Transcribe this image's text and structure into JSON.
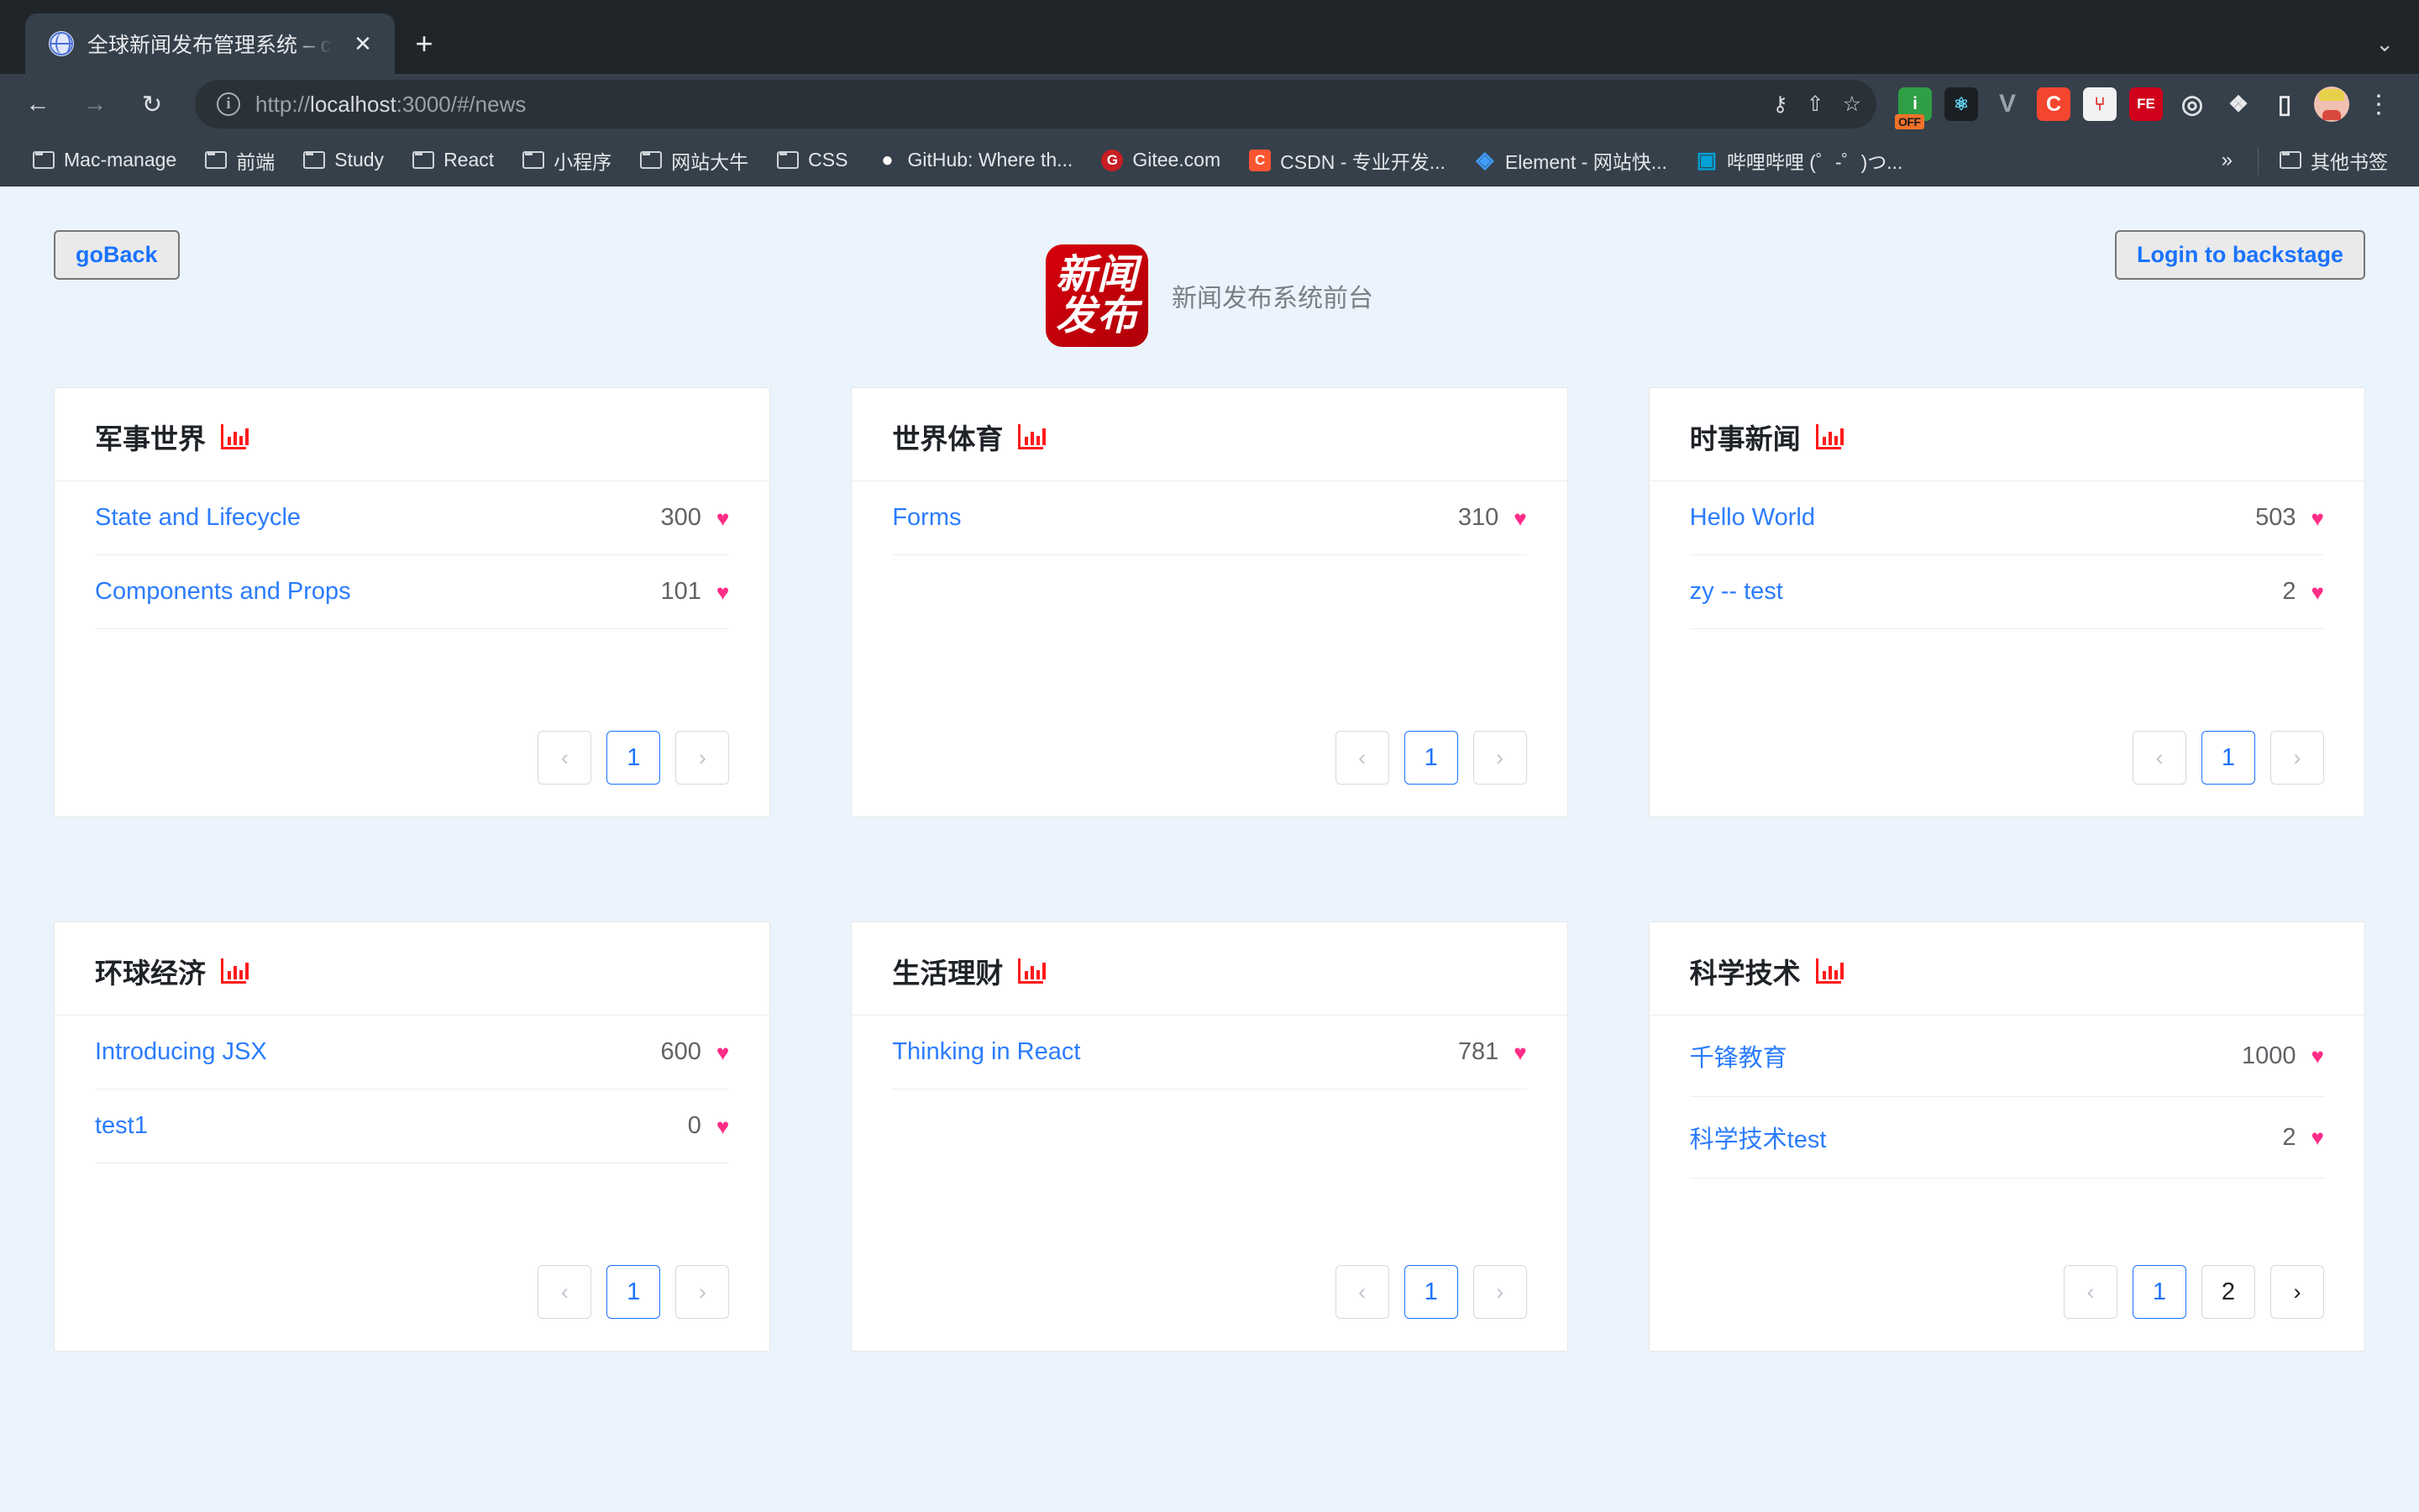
{
  "browser": {
    "tab": {
      "title": "全球新闻发布管理系统 – codeMa",
      "favicon_name": "globe-icon",
      "close_label": "✕",
      "newtab_label": "+"
    },
    "tabstrip_chevron": "⌄",
    "nav": {
      "back": "←",
      "forward": "→",
      "reload": "↻"
    },
    "omnibox": {
      "info_icon": "i",
      "url_strong": "localhost",
      "url_prefix": "http://",
      "url_suffix": ":3000/#/news",
      "url_full": "http://localhost:3000/#/news",
      "actions": [
        {
          "name": "password-key-icon",
          "glyph": "⚷"
        },
        {
          "name": "share-icon",
          "glyph": "⇧"
        },
        {
          "name": "bookmark-star-icon",
          "glyph": "☆"
        }
      ]
    },
    "extensions": [
      {
        "name": "adblock-off-icon",
        "label": "i",
        "bg": "#2f9e44",
        "badge": "OFF"
      },
      {
        "name": "react-devtools-icon",
        "label": "⚛",
        "bg": "#1b1f23",
        "color": "#61dafb"
      },
      {
        "name": "vue-devtools-icon",
        "label": "V",
        "bg": "transparent",
        "color": "#9aa3ab"
      },
      {
        "name": "clipboard-c-icon",
        "label": "C",
        "bg": "#f4452e"
      },
      {
        "name": "sitemap-icon",
        "label": "⑂",
        "bg": "#f2f2f2",
        "color": "#e03131"
      },
      {
        "name": "fehelper-icon",
        "label": "FE",
        "bg": "#d0021b"
      },
      {
        "name": "target-icon",
        "label": "◎",
        "bg": "transparent",
        "color": "#dfe3e7"
      }
    ],
    "puzzle_icon": "❖",
    "cast_icon": "▯",
    "avatar_name": "user-avatar",
    "kebab_icon": "⋮",
    "bookmarks": [
      {
        "name": "bookmark-mac-manage",
        "type": "folder",
        "label": "Mac-manage"
      },
      {
        "name": "bookmark-qianduan",
        "type": "folder",
        "label": "前端"
      },
      {
        "name": "bookmark-study",
        "type": "folder",
        "label": "Study"
      },
      {
        "name": "bookmark-react",
        "type": "folder",
        "label": "React"
      },
      {
        "name": "bookmark-xiaochengxu",
        "type": "folder",
        "label": "小程序"
      },
      {
        "name": "bookmark-wangzhandaniu",
        "type": "folder",
        "label": "网站大牛"
      },
      {
        "name": "bookmark-css",
        "type": "folder",
        "label": "CSS"
      },
      {
        "name": "bookmark-github",
        "type": "site",
        "label": "GitHub: Where th...",
        "glyph": "●",
        "bg": "#35404a",
        "color": "#ffffff"
      },
      {
        "name": "bookmark-gitee",
        "type": "site",
        "label": "Gitee.com",
        "glyph": "G",
        "bg": "#c71d23",
        "color": "#ffffff"
      },
      {
        "name": "bookmark-csdn",
        "type": "site",
        "label": "CSDN - 专业开发...",
        "glyph": "C",
        "bg": "#fc5531",
        "color": "#ffffff"
      },
      {
        "name": "bookmark-element",
        "type": "site",
        "label": "Element - 网站快...",
        "glyph": "◈",
        "bg": "#409eff",
        "color": "#ffffff"
      },
      {
        "name": "bookmark-bilibili",
        "type": "site",
        "label": "哔哩哔哩 (゜-゜)つ...",
        "glyph": "▣",
        "bg": "#00a1d6",
        "color": "#ffffff"
      }
    ],
    "bookmarks_overflow": "»",
    "other_bookmarks": {
      "name": "other-bookmarks",
      "label": "其他书签"
    }
  },
  "page": {
    "go_back_label": "goBack",
    "login_label": "Login to backstage",
    "logo": {
      "line1": "新闻",
      "line2": "发布"
    },
    "brand_subtitle": "新闻发布系统前台",
    "accent_blue": "#2b7cff",
    "heart_pink": "#ff2d87",
    "logo_red": "#c40710",
    "bg": "#ebf4fd",
    "chart_icon_name": "bar-chart-icon",
    "heart_glyph": "♥",
    "prev_glyph": "‹",
    "next_glyph": "›",
    "cards": [
      {
        "name": "card-military-world",
        "title": "军事世界",
        "items": [
          {
            "title": "State and Lifecycle",
            "count": "300"
          },
          {
            "title": "Components and Props",
            "count": "101"
          }
        ],
        "pages": [
          "1"
        ],
        "active_page": "1",
        "prev_enabled": false,
        "next_enabled": false
      },
      {
        "name": "card-world-sports",
        "title": "世界体育",
        "items": [
          {
            "title": "Forms",
            "count": "310"
          }
        ],
        "pages": [
          "1"
        ],
        "active_page": "1",
        "prev_enabled": false,
        "next_enabled": false
      },
      {
        "name": "card-current-news",
        "title": "时事新闻",
        "items": [
          {
            "title": "Hello World",
            "count": "503"
          },
          {
            "title": "zy -- test",
            "count": "2"
          }
        ],
        "pages": [
          "1"
        ],
        "active_page": "1",
        "prev_enabled": false,
        "next_enabled": false
      },
      {
        "name": "card-global-economy",
        "title": "环球经济",
        "items": [
          {
            "title": "Introducing JSX",
            "count": "600"
          },
          {
            "title": "test1",
            "count": "0"
          }
        ],
        "pages": [
          "1"
        ],
        "active_page": "1",
        "prev_enabled": false,
        "next_enabled": false
      },
      {
        "name": "card-life-finance",
        "title": "生活理财",
        "items": [
          {
            "title": "Thinking in React",
            "count": "781"
          }
        ],
        "pages": [
          "1"
        ],
        "active_page": "1",
        "prev_enabled": false,
        "next_enabled": false
      },
      {
        "name": "card-science-technology",
        "title": "科学技术",
        "items": [
          {
            "title": "千锋教育",
            "count": "1000"
          },
          {
            "title": "科学技术test",
            "count": "2"
          }
        ],
        "pages": [
          "1",
          "2"
        ],
        "active_page": "1",
        "prev_enabled": false,
        "next_enabled": true
      }
    ]
  }
}
